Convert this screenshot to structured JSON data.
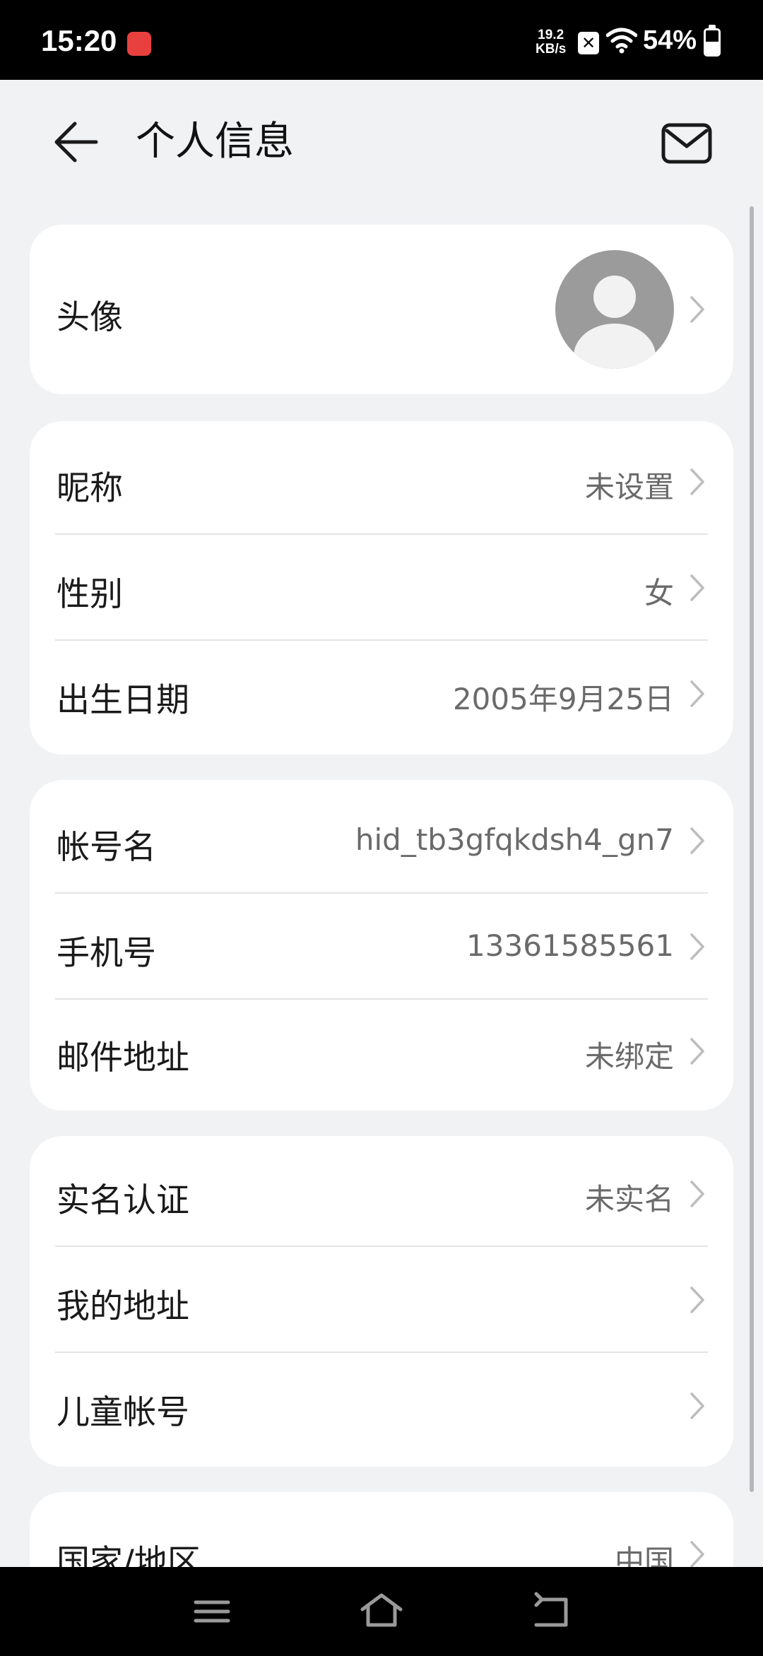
{
  "status_bar": {
    "time": "15:20",
    "net_speed_value": "19.2",
    "net_speed_unit": "KB/s",
    "battery": "54%",
    "battery_level": 0.54,
    "app_icon_color": "#e8403f"
  },
  "header": {
    "title": "个人信息",
    "back_icon": "arrow-left-icon",
    "mail_icon": "mail-icon"
  },
  "sections": {
    "avatar": {
      "label": "头像"
    },
    "profile": [
      {
        "label": "昵称",
        "value": "未设置"
      },
      {
        "label": "性别",
        "value": "女"
      },
      {
        "label": "出生日期",
        "value": "2005年9月25日"
      }
    ],
    "account": [
      {
        "label": "帐号名",
        "value": "hid_tb3gfqkdsh4_gn7"
      },
      {
        "label": "手机号",
        "value": "13361585561"
      },
      {
        "label": "邮件地址",
        "value": "未绑定"
      }
    ],
    "other": [
      {
        "label": "实名认证",
        "value": "未实名"
      },
      {
        "label": "我的地址",
        "value": ""
      },
      {
        "label": "儿童帐号",
        "value": ""
      }
    ],
    "region": {
      "label": "国家/地区",
      "value": "中国"
    }
  },
  "nav_bar": {
    "menu_icon": "menu-icon",
    "home_icon": "home-icon",
    "back_icon": "back-icon"
  }
}
